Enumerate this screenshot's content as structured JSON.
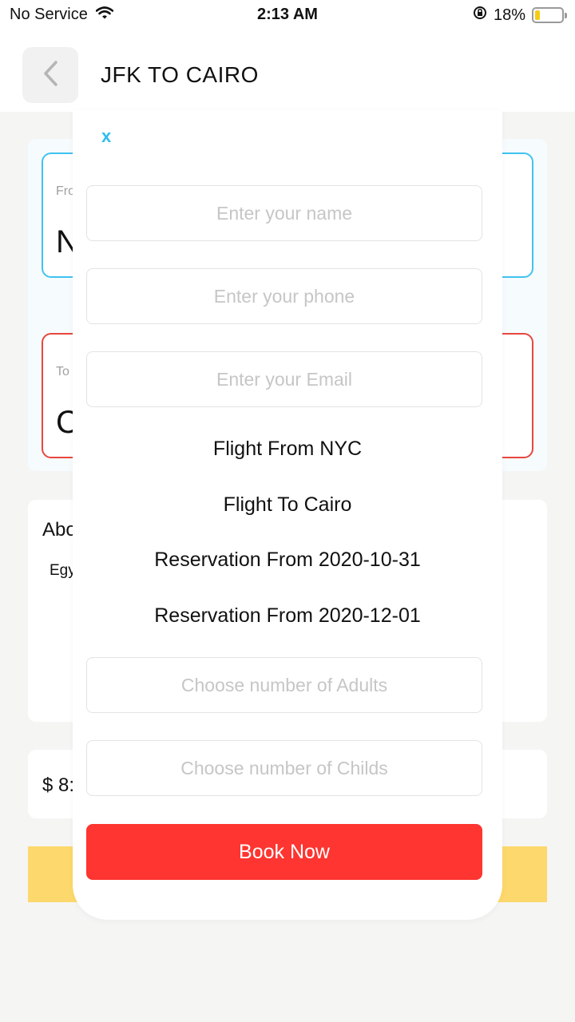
{
  "status_bar": {
    "carrier": "No Service",
    "time": "2:13 AM",
    "battery": "18%",
    "battery_level": 0.18,
    "icons": [
      "wifi-icon",
      "orientation-lock-icon",
      "battery-icon"
    ]
  },
  "header": {
    "title": "JFK TO CAIRO",
    "back_icon": "chevron-left-icon"
  },
  "background": {
    "from_label": "Fro",
    "from_value": "N",
    "to_label": "To",
    "to_value": "C",
    "about_title": "Abo",
    "about_text": "Egу",
    "price": "$ 8:",
    "colors": {
      "from_border": "#3fc3ef",
      "to_border": "#e8473e",
      "book_bar": "#fdd86c"
    }
  },
  "modal": {
    "close_label": "x",
    "name_placeholder": "Enter your name",
    "phone_placeholder": "Enter your phone",
    "email_placeholder": "Enter your Email",
    "flight_from": "Flight From NYC",
    "flight_to": "Flight To Cairo",
    "reservation_from": "Reservation From 2020-10-31",
    "reservation_to": "Reservation From 2020-12-01",
    "adults_placeholder": "Choose number of Adults",
    "childs_placeholder": "Choose number of Childs",
    "book_label": "Book Now",
    "colors": {
      "close": "#2ebdef",
      "book_button": "#fe3530"
    }
  }
}
